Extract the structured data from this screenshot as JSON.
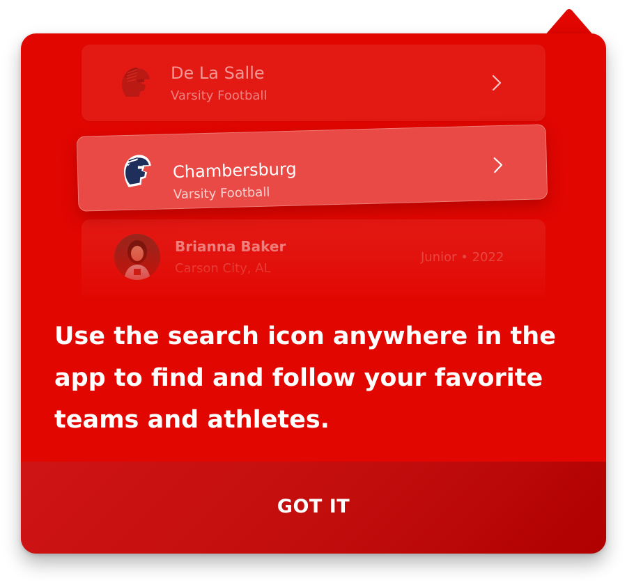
{
  "colors": {
    "popover_background": "#e10600",
    "footer_background": "#c20d0d",
    "text_primary": "#ffffff"
  },
  "preview_cards": [
    {
      "icon": "trojan-helmet-logo-icon",
      "name": "De La Salle",
      "subtitle": "Varsity Football"
    },
    {
      "icon": "spartan-helmet-logo-icon",
      "name": "Chambersburg",
      "subtitle": "Varsity Football"
    }
  ],
  "athlete_card": {
    "icon": "athlete-avatar",
    "name": "Brianna Baker",
    "location": "Carson City, AL",
    "meta": "Junior • 2022"
  },
  "message": "Use the search icon anywhere in the app to find and follow your favorite teams and athletes.",
  "footer": {
    "button_label": "GOT IT"
  }
}
